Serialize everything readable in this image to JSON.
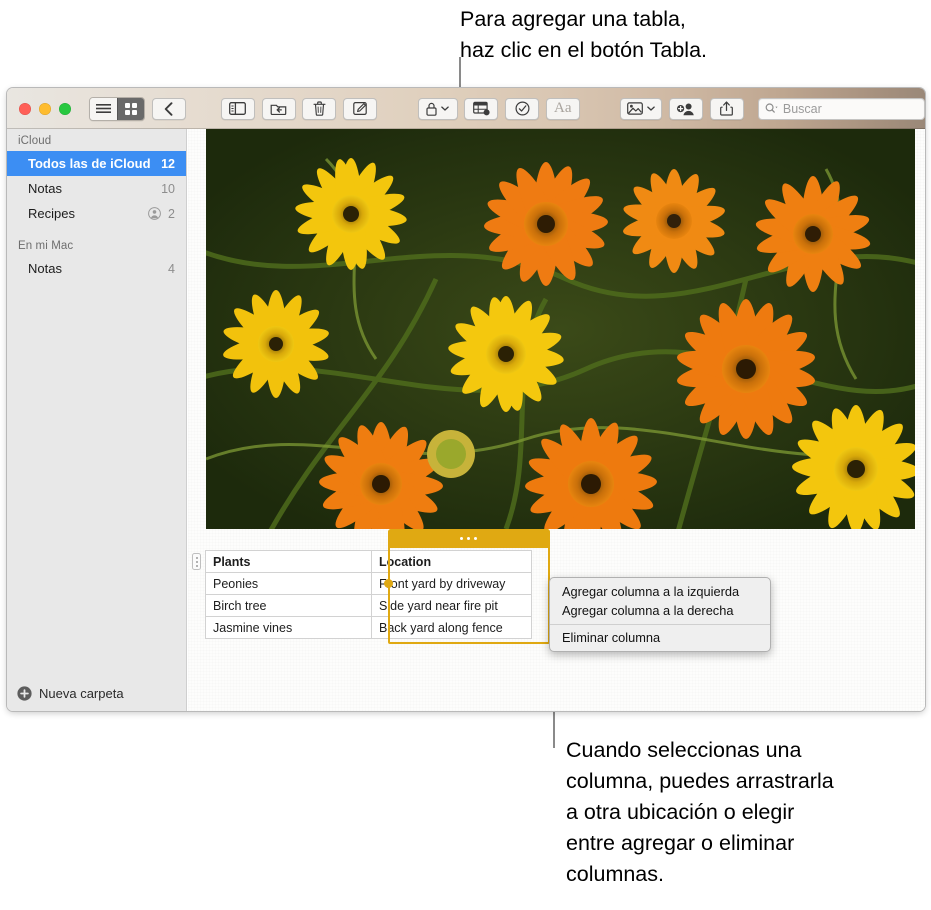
{
  "callouts": {
    "top": "Para agregar una tabla,\nhaz clic en el botón Tabla.",
    "bottom": "Cuando seleccionas una\ncolumna, puedes arrastrarla\na otra ubicación o elegir\nentre agregar o eliminar\ncolumnas."
  },
  "toolbar": {
    "view_list_icon": "list-view-icon",
    "view_grid_icon": "grid-view-icon",
    "back_icon": "back-chevron-icon",
    "sidebar_icon": "sidebar-toggle-icon",
    "move_icon": "move-to-folder-icon",
    "trash_icon": "trash-icon",
    "compose_icon": "compose-note-icon",
    "lock_icon": "lock-icon",
    "table_icon": "table-icon",
    "checklist_icon": "checklist-icon",
    "format_label": "Aa",
    "media_icon": "media-icon",
    "add_person_icon": "add-person-icon",
    "share_icon": "share-icon",
    "search_placeholder": "Buscar",
    "search_value": "",
    "search_icon": "search-icon"
  },
  "sidebar": {
    "sections": [
      {
        "header": "iCloud",
        "items": [
          {
            "label": "Todos las de iCloud",
            "count": "12",
            "selected": true,
            "shared": false
          },
          {
            "label": "Notas",
            "count": "10",
            "selected": false,
            "shared": false
          },
          {
            "label": "Recipes",
            "count": "2",
            "selected": false,
            "shared": true
          }
        ]
      },
      {
        "header": "En mi Mac",
        "items": [
          {
            "label": "Notas",
            "count": "4",
            "selected": false,
            "shared": false
          }
        ]
      }
    ],
    "new_folder_label": "Nueva carpeta",
    "new_folder_icon": "plus-circle-icon"
  },
  "note": {
    "photo_alt": "orange-and-yellow-daisy-flowers-photo",
    "table": {
      "columns": [
        "Plants",
        "Location"
      ],
      "rows": [
        [
          "Peonies",
          "Front yard by driveway"
        ],
        [
          "Birch tree",
          "Side yard near fire pit"
        ],
        [
          "Jasmine vines",
          "Back yard along fence"
        ]
      ],
      "selected_column_index": 1,
      "selection_color": "#e0a912"
    }
  },
  "context_menu": {
    "items": [
      {
        "label": "Agregar columna a la izquierda",
        "separator_after": false
      },
      {
        "label": "Agregar columna a la derecha",
        "separator_after": true
      },
      {
        "label": "Eliminar columna",
        "separator_after": false
      }
    ]
  },
  "colors": {
    "selection_blue": "#3c8ef3",
    "table_selection": "#e0a912",
    "sidebar_bg": "#e8e8e8"
  }
}
